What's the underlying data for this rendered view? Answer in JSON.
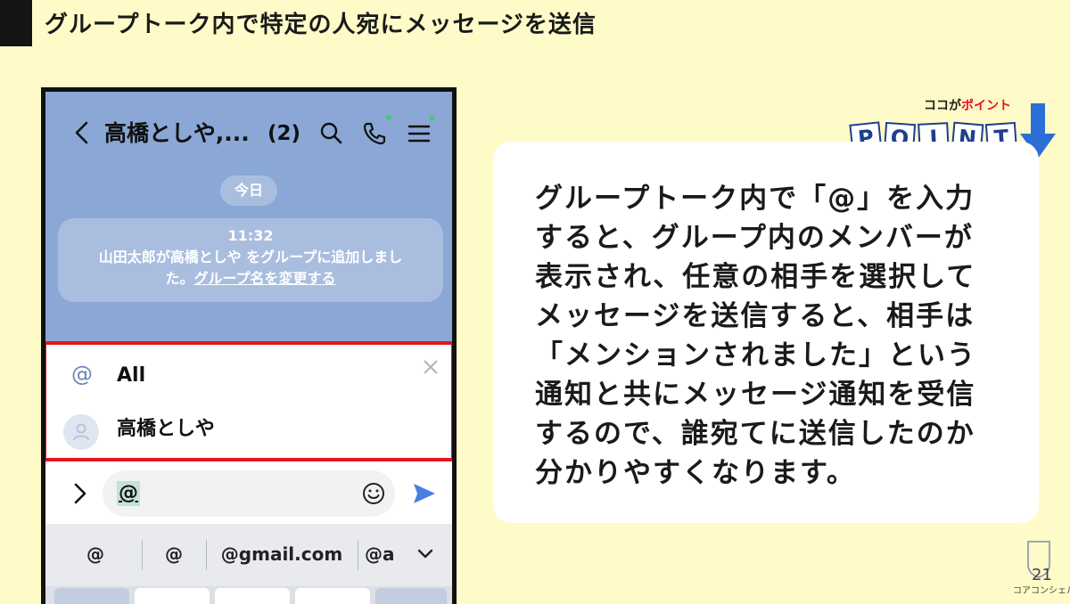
{
  "slide": {
    "title": "グループトーク内で特定の人宛にメッセージを送信",
    "page_number": "21",
    "brand": "コアコンシェル"
  },
  "phone": {
    "chat_title": "高橋としや,...",
    "member_count": "(2)",
    "date_chip": "今日",
    "system_message": {
      "time": "11:32",
      "line1": "山田太郎が高橋としや をグループに追加しまし",
      "line2_prefix": "た。",
      "link": "グループ名を変更する"
    },
    "mention_list": [
      {
        "icon": "at-icon",
        "label": "All"
      },
      {
        "icon": "avatar",
        "label": "高橋としや"
      }
    ],
    "input": {
      "value": "@"
    },
    "suggestions": [
      "@",
      "@",
      "@gmail.com",
      "@a"
    ],
    "colors": {
      "chat_bg": "#8aa7d6",
      "highlight_border": "#e3141d",
      "send": "#4a7fe0"
    }
  },
  "point_badge": {
    "caption_prefix": "ココが",
    "caption_highlight": "ポイント",
    "letters": [
      "P",
      "O",
      "I",
      "N",
      "T"
    ],
    "tile_colors": [
      "#ffffff",
      "#ffffff",
      "#ffffff",
      "#ffffff",
      "#ffffff"
    ]
  },
  "explanation": {
    "lines": [
      "グループトーク内で「@」を入力",
      "すると、グループ内のメンバーが",
      "表示され、任意の相手を選択して",
      "メッセージを送信すると、相手は",
      "「メンションされました」という",
      "通知と共にメッセージ通知を受信",
      "するので、誰宛てに送信したのか",
      "分かりやすくなります。"
    ]
  }
}
